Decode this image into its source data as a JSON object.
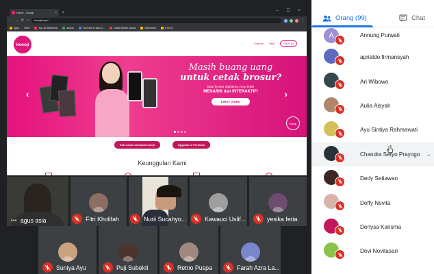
{
  "browser": {
    "tab_title": "Home - Imooji",
    "url": "imooji.com/",
    "bookmarks": [
      "Apps",
      "UPM",
      "Top 10 Slideshow",
      "aksyai",
      "YouTube to Mp3 C...",
      "Daftar Artikel Masuk",
      "cariberaini",
      "e-FILM"
    ]
  },
  "site": {
    "logo": "imooji",
    "nav": [
      "Explore",
      "Help",
      "SIGN IN"
    ],
    "hero_line1": "Masih buang uang",
    "hero_line2": "untuk cetak brosur?",
    "hero_sub1": "Buat brosur digitalmu yang lebih",
    "hero_sub2": "MENARIK dan INTERAKTIF!",
    "hero_button": "LIHAT VIDEO",
    "hero_badge": "imooji",
    "cta_left": "Klik untuk membuat imooji",
    "cta_right": "Upgrade to Premium",
    "section_title": "Keunggulan Kami"
  },
  "tiles": [
    {
      "name": "agus asia",
      "bg": "#3a3a36"
    },
    {
      "name": "Fitri Kholifah",
      "avatar_color": "#8d6e63"
    },
    {
      "name": "Nurii Sucahyo...",
      "bg": "#e9e4d8"
    },
    {
      "name": "Kawauci Uslif...",
      "avatar_color": "#9e9e9e"
    },
    {
      "name": "yesika feria",
      "avatar_color": "#6d4c6f"
    },
    {
      "name": "Suniya Ayu",
      "avatar_color": "#c9a27e"
    },
    {
      "name": "Puji Subekti",
      "avatar_color": "#4e342e"
    },
    {
      "name": "Retno Puspa",
      "avatar_color": "#a1887f"
    },
    {
      "name": "Farah Azra La...",
      "avatar_color": "#7986cb"
    }
  ],
  "panel": {
    "people_tab": "Orang (99)",
    "chat_tab": "Chat",
    "participants": [
      {
        "name": "Annung Purwati",
        "initial": "A",
        "color": "#9e8fd6"
      },
      {
        "name": "aprialdo firmansyah",
        "color": "#5c6bc0"
      },
      {
        "name": "Ari Wibowo",
        "color": "#37474f"
      },
      {
        "name": "Aulia Aisyah",
        "color": "#b0876a"
      },
      {
        "name": "Ayu Sintiya Rahmawati",
        "color": "#d4c05a"
      },
      {
        "name": "Chandra Setyo Prayogo",
        "color": "#263238"
      },
      {
        "name": "Dedy Setiawan",
        "color": "#3e2723"
      },
      {
        "name": "Deffy Novita",
        "color": "#d7b3a8"
      },
      {
        "name": "Denysa Karisma",
        "color": "#c2185b"
      },
      {
        "name": "Devi Novitasari",
        "color": "#8bc34a"
      }
    ]
  }
}
